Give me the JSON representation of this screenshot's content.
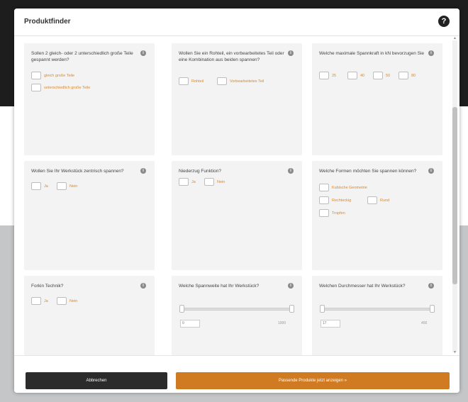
{
  "modal": {
    "title": "Produktfinder",
    "help_icon": "?"
  },
  "cards": [
    {
      "question": "Sollen 2 gleich- oder 2 unterschiedlich große Teile gespannt werden?",
      "options": [
        "gleich große Teile",
        "unterschiedlich große Teile"
      ]
    },
    {
      "question": "Wollen Sie ein Rohteil, ein vorbearbeitetes Teil oder eine Kombination aus beiden spannen?",
      "options": [
        "Rohteil",
        "Vorbearbeitetes Teil"
      ]
    },
    {
      "question": "Welche maximale Spannkraft in kN bevorzugen Sie",
      "options": [
        "25",
        "40",
        "50",
        "80"
      ]
    },
    {
      "question": "Wollen Sie Ihr Werkstück zentrisch spannen?",
      "options": [
        "Ja",
        "Nein"
      ]
    },
    {
      "question": "Niederzug Funktion?",
      "options": [
        "Ja",
        "Nein"
      ]
    },
    {
      "question": "Welche Formen möchten Sie spannen können?",
      "options": [
        "Kubische Geometrie",
        "Rechteckig",
        "Rund",
        "Tropfen"
      ]
    },
    {
      "question": "Forkin Technik?",
      "options": [
        "Ja",
        "Nein"
      ]
    },
    {
      "question": "Welche Spannweite hat Ihr Werkstück?",
      "range_min": "0",
      "range_max": "1000"
    },
    {
      "question": "Welchen Durchmesser hat Ihr Werkstück?",
      "range_min": "17",
      "range_max": "400"
    }
  ],
  "info_icon": "i",
  "footer": {
    "cancel_label": "Abbrechen",
    "show_label": "Passende Produkte jetzt anzeigen »"
  },
  "colors": {
    "accent": "#d07a22",
    "dark_button": "#2b2b2b",
    "card_bg": "#f3f3f3"
  }
}
